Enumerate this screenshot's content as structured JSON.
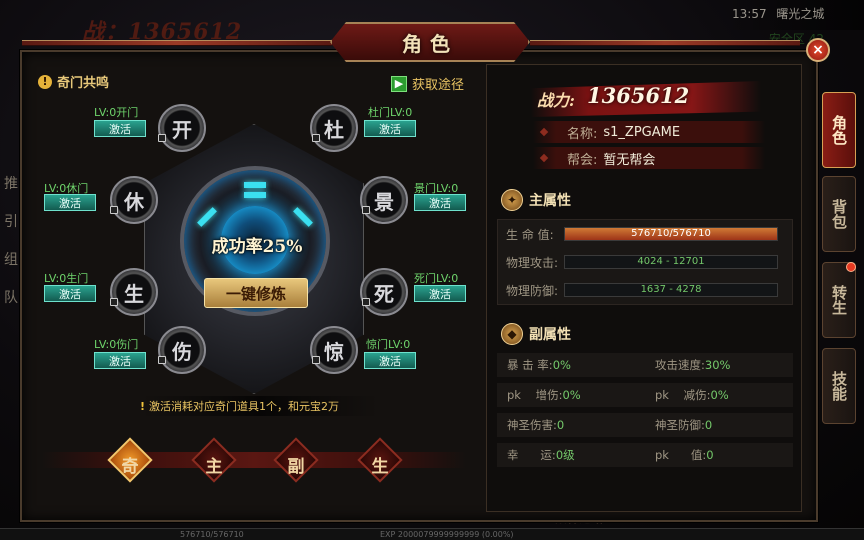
{
  "background": {
    "power_text": "战：1365612",
    "time": "13:57",
    "map_name": "曙光之城",
    "extra_status": "安全区 42",
    "side_chars": [
      "推",
      "引",
      "组",
      "队"
    ],
    "hp_text": "576710/576710",
    "exp_text": "EXP 2000079999999999 (0.00%)",
    "bottom_logo": "战神之路"
  },
  "window": {
    "title": "角色",
    "close_label": "×"
  },
  "qimen": {
    "title": "奇门共鸣",
    "get_path_label": "获取途径",
    "success_rate": "成功率25%",
    "one_click_label": "一键修炼",
    "consume_note": "激活消耗对应奇门道具1个，和元宝2万",
    "activate_label": "激活",
    "gates": [
      {
        "name": "开门",
        "level": "LV:0开门",
        "glyph": "开"
      },
      {
        "name": "杜门",
        "level": "杜门LV:0",
        "glyph": "杜"
      },
      {
        "name": "休门",
        "level": "LV:0休门",
        "glyph": "休"
      },
      {
        "name": "景门",
        "level": "景门LV:0",
        "glyph": "景"
      },
      {
        "name": "生门",
        "level": "LV:0生门",
        "glyph": "生"
      },
      {
        "name": "死门",
        "level": "死门LV:0",
        "glyph": "死"
      },
      {
        "name": "伤门",
        "level": "LV:0伤门",
        "glyph": "伤"
      },
      {
        "name": "惊门",
        "level": "惊门LV:0",
        "glyph": "惊"
      }
    ],
    "bottom_tabs": [
      "奇",
      "主",
      "副",
      "生"
    ],
    "active_tab": "奇"
  },
  "character": {
    "power_label": "战力:",
    "power_value": "1365612",
    "name_label": "名称:",
    "name_value": "s1_ZPGAME",
    "guild_label": "帮会:",
    "guild_value": "暂无帮会",
    "main_attr_title": "主属性",
    "main_attrs": [
      {
        "label": "生 命 值:",
        "value": "576710/576710",
        "fill": 1.0
      },
      {
        "label": "物理攻击:",
        "value": "4024 - 12701",
        "fill": 0.0
      },
      {
        "label": "物理防御:",
        "value": "1637 - 4278",
        "fill": 0.0
      }
    ],
    "sub_attr_title": "副属性",
    "sub_attrs": [
      [
        {
          "label": "暴 击 率:",
          "value": "0%"
        },
        {
          "label": "攻击速度:",
          "value": "30%"
        }
      ],
      [
        {
          "label": "pk    增伤:",
          "value": "0%"
        },
        {
          "label": "pk    减伤:",
          "value": "0%"
        }
      ],
      [
        {
          "label": "神圣伤害:",
          "value": "0"
        },
        {
          "label": "神圣防御:",
          "value": "0"
        }
      ],
      [
        {
          "label": "幸      运:",
          "value": "0级"
        },
        {
          "label": "pk      值:",
          "value": "0"
        }
      ]
    ]
  },
  "side_tabs": [
    "角色",
    "背包",
    "转生",
    "技能"
  ],
  "active_side_tab": "角色",
  "colors": {
    "accent_gold": "#e9c463",
    "hp_bar": "#c9622c",
    "activate_green": "#2aa28f",
    "attr_value_green": "#74c86a"
  }
}
